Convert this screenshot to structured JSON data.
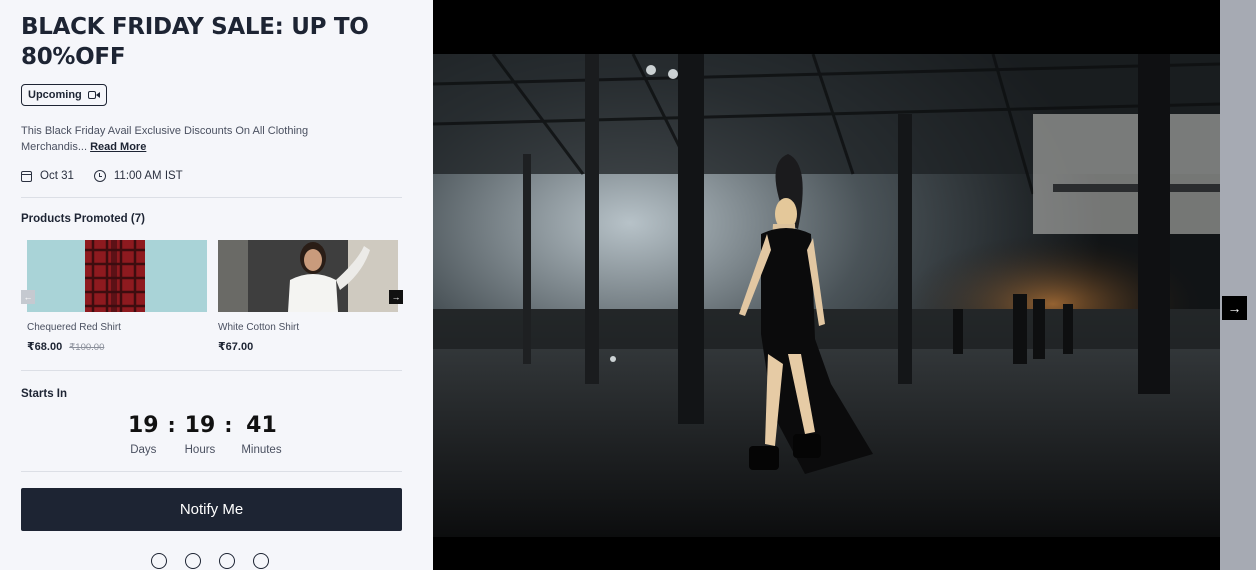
{
  "event": {
    "title": "BLACK FRIDAY SALE: UP TO 80%OFF",
    "status_badge": "Upcoming",
    "description": "This Black Friday Avail Exclusive Discounts On All Clothing Merchandis...",
    "read_more": "Read More",
    "date": "Oct 31",
    "time": "11:00 AM IST"
  },
  "products": {
    "heading": "Products Promoted (7)",
    "items": [
      {
        "name": "Chequered Red Shirt",
        "price": "₹68.00",
        "old_price": "₹100.00"
      },
      {
        "name": "White Cotton Shirt",
        "price": "₹67.00",
        "old_price": ""
      }
    ]
  },
  "countdown": {
    "heading": "Starts In",
    "days": "19",
    "hours": "19",
    "minutes": "41",
    "days_label": "Days",
    "hours_label": "Hours",
    "minutes_label": "Minutes",
    "separator": ":"
  },
  "notify_button": "Notify Me",
  "icons": {
    "badge": "video-camera-icon",
    "date": "calendar-icon",
    "time": "clock-icon",
    "carousel_prev": "arrow-left-icon",
    "carousel_next": "arrow-right-icon",
    "media_next": "arrow-right-icon"
  },
  "colors": {
    "dark": "#1d2433",
    "panel_bg": "#f5f6fa",
    "strip": "#a6aab3"
  }
}
